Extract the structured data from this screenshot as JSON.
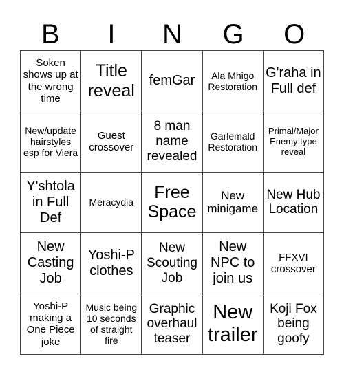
{
  "header": {
    "letters": [
      "B",
      "I",
      "N",
      "G",
      "O"
    ]
  },
  "cells": [
    {
      "text": "Soken shows up at the wrong time"
    },
    {
      "text": "Title reveal"
    },
    {
      "text": "femGar"
    },
    {
      "text": "Ala Mhigo Restoration"
    },
    {
      "text": "G'raha in Full def"
    },
    {
      "text": "New/update hairstyles esp for Viera"
    },
    {
      "text": "Guest crossover"
    },
    {
      "text": "8 man name revealed"
    },
    {
      "text": "Garlemald Restoration"
    },
    {
      "text": "Primal/Major Enemy type reveal"
    },
    {
      "text": "Y'shtola in Full Def"
    },
    {
      "text": "Meracydia"
    },
    {
      "text": "Free Space"
    },
    {
      "text": "New minigame"
    },
    {
      "text": "New Hub Location"
    },
    {
      "text": "New Casting Job"
    },
    {
      "text": "Yoshi-P clothes"
    },
    {
      "text": "New Scouting Job"
    },
    {
      "text": "New NPC to join us"
    },
    {
      "text": "FFXVI crossover"
    },
    {
      "text": "Yoshi-P making a One Piece joke"
    },
    {
      "text": "Music being 10 seconds of straight fire"
    },
    {
      "text": "Graphic overhaul teaser"
    },
    {
      "text": "New trailer"
    },
    {
      "text": "Koji Fox being goofy"
    }
  ]
}
